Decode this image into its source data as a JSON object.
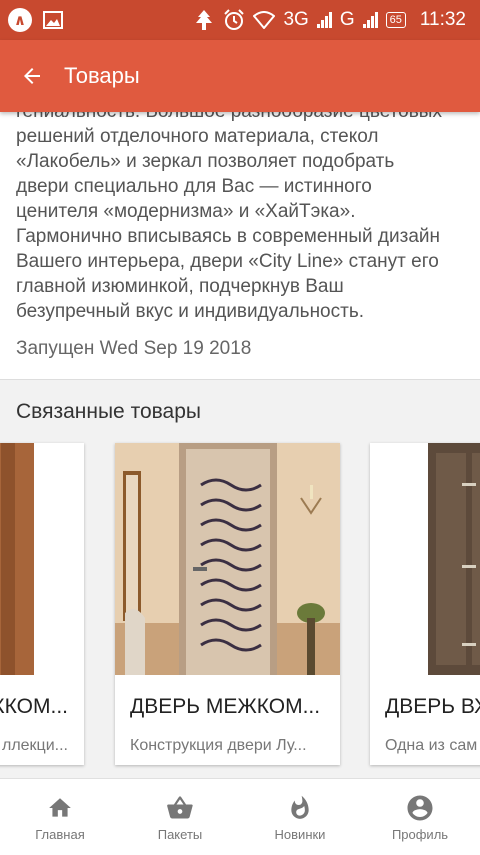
{
  "status_bar": {
    "network_3g": "3G",
    "network_g": "G",
    "battery": "65",
    "time": "11:32"
  },
  "header": {
    "title": "Товары"
  },
  "description": {
    "lines": [
      "гениальность. Большое разнообразие цветовых",
      "решений отделочного материала, стекол",
      "«Лакобель» и зеркал позволяет подобрать",
      "двери специально для Вас — истинного",
      "ценителя «модернизма» и «ХайТэка».",
      "Гармонично вписываясь в современный дизайн",
      "Вашего интерьера, двери «City Line» станут его",
      "главной изюминкой, подчеркнув Ваш",
      "безупречный вкус и индивидуальность."
    ]
  },
  "launch_text": "Запущен Wed Sep 19 2018",
  "related": {
    "title": "Связанные товары",
    "cards": [
      {
        "title": "ЖКОМ...",
        "subtitle": "ллекци..."
      },
      {
        "title": "ДВЕРЬ МЕЖКОМ...",
        "subtitle": "Конструкция двери Лу..."
      },
      {
        "title": "ДВЕРЬ ВХ",
        "subtitle": "Одна из сам"
      }
    ]
  },
  "bottom_nav": [
    {
      "label": "Главная",
      "icon": "home-icon"
    },
    {
      "label": "Пакеты",
      "icon": "basket-icon"
    },
    {
      "label": "Новинки",
      "icon": "fire-icon"
    },
    {
      "label": "Профиль",
      "icon": "account-icon"
    }
  ],
  "colors": {
    "status_bar": "#c8492f",
    "app_bar": "#e05a3f",
    "nav_icon": "#777777"
  }
}
